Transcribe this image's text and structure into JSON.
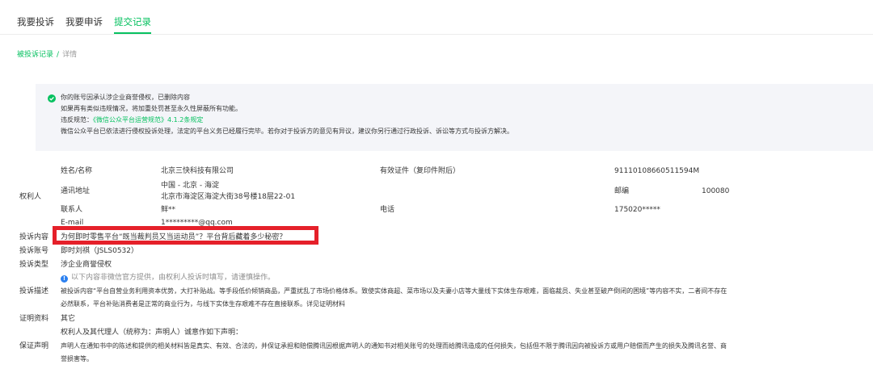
{
  "tabs": [
    {
      "label": "我要投诉"
    },
    {
      "label": "我要申诉"
    },
    {
      "label": "提交记录"
    }
  ],
  "breadcrumb": {
    "parent": "被投诉记录",
    "sep": "/",
    "current": "详情"
  },
  "notice": {
    "line1": "你的账号因承认涉企业商誉侵权，已删除内容",
    "line2": "如果再有类似违规情况，将加重处罚甚至永久性屏蔽所有功能。",
    "line3_prefix": "违反规范：",
    "line3_link": "《微信公众平台运营规范》4.1.2条规定",
    "line4": "微信公众平台已依法进行侵权投诉处理，法定的平台义务已经履行完毕。若你对于投诉方的意见有异议，建议你另行通过行政投诉、诉讼等方式与投诉方解决。"
  },
  "rights_holder": {
    "section_label": "权利人",
    "name_label": "姓名/名称",
    "name_value": "北京三快科技有限公司",
    "cert_label": "有效证件（复印件附后）",
    "cert_value": "91110108660511594M",
    "address_label": "通讯地址",
    "address_line1": "中国 - 北京 - 海淀",
    "address_line2": "北京市海淀区海淀大街38号楼18层22-01",
    "postcode_label": "邮编",
    "postcode_value": "100080",
    "contact_label": "联系人",
    "contact_value": "鲜**",
    "phone_label": "电话",
    "phone_value": "175020*****",
    "email_label": "E-mail",
    "email_value": "1*********@qq.com"
  },
  "complaint": {
    "content_label": "投诉内容",
    "content_value": "为何即时零售平台“既当裁判员又当运动员”？平台背后藏着多少秘密？",
    "account_label": "投诉账号",
    "account_value": "即时刘祺（JSLS0532）",
    "type_label": "投诉类型",
    "type_value": "涉企业商誉侵权",
    "hint_icon": "info-icon",
    "hint": "以下内容非微信官方提供，由权利人投诉时填写，请谨慎操作。",
    "desc_label": "投诉描述",
    "desc_line1": "被投诉内容“平台自营业务利用资本优势，大打补贴战。等手段低价倾销商品，严重扰乱了市场价格体系。致使实体商超、菜市场以及夫妻小店等大量线下实体生存艰难，面临裁员、失业甚至破产倒闭的困境”等内容不实，二者间不存在",
    "desc_line2": "必然联系，平台补贴消费者是正常的商业行为，与线下实体生存艰难不存在直接联系。详见证明材料",
    "evidence_label": "证明资料",
    "evidence_value": "其它",
    "guarantee_label": "保证声明",
    "guarantee_line1": "权利人及其代理人（统称为：声明人）诚意作如下声明：",
    "guarantee_line2": "声明人在通知书中的陈述和提供的相关材料皆是真实、有效、合法的，并保证承担和赔偿腾讯因根据声明人的通知书对相关账号的处理而给腾讯造成的任何损失，包括但不限于腾讯因向被投诉方或用户赔偿而产生的损失及腾讯名誉、商",
    "guarantee_line3": "誉损害等。"
  },
  "colors": {
    "accent": "#07c160",
    "highlight_box": "#e5202a",
    "info": "#2b80f0"
  }
}
